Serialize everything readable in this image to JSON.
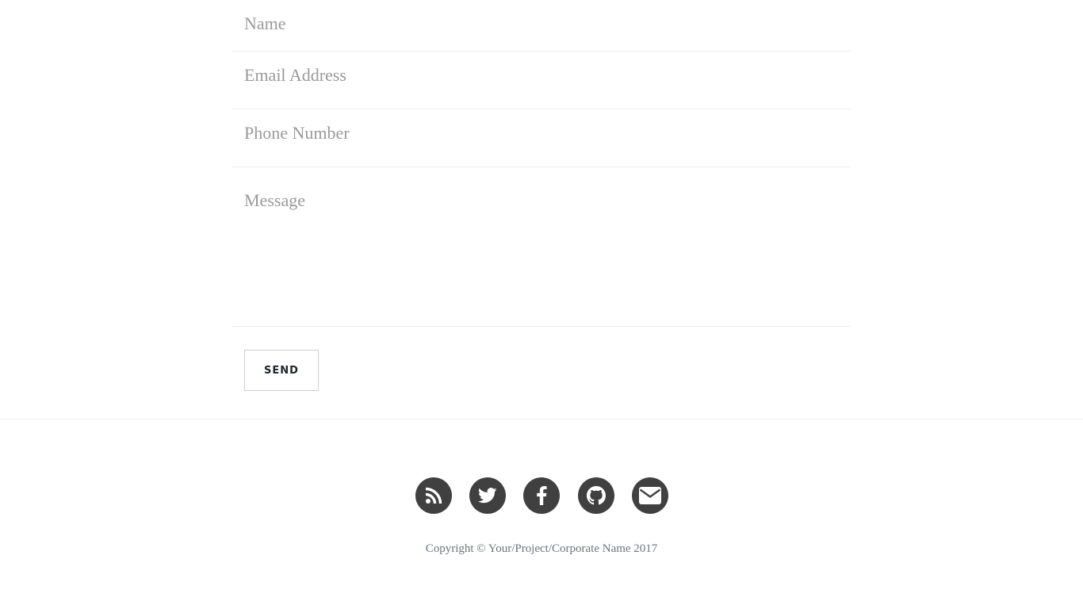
{
  "contact_form": {
    "name_placeholder": "Name",
    "email_placeholder": "Email Address",
    "phone_placeholder": "Phone Number",
    "message_placeholder": "Message",
    "send_label": "SEND"
  },
  "footer": {
    "social_links": [
      {
        "icon": "rss-icon"
      },
      {
        "icon": "twitter-icon"
      },
      {
        "icon": "facebook-icon"
      },
      {
        "icon": "github-icon"
      },
      {
        "icon": "envelope-icon"
      }
    ],
    "copyright": "Copyright © Your/Project/Corporate Name 2017"
  },
  "colors": {
    "icon_circle": "#404040",
    "icon_glyph": "#ffffff",
    "divider": "#eeeeee",
    "placeholder": "#9a9a9a",
    "button_border": "#cfcfcf"
  }
}
